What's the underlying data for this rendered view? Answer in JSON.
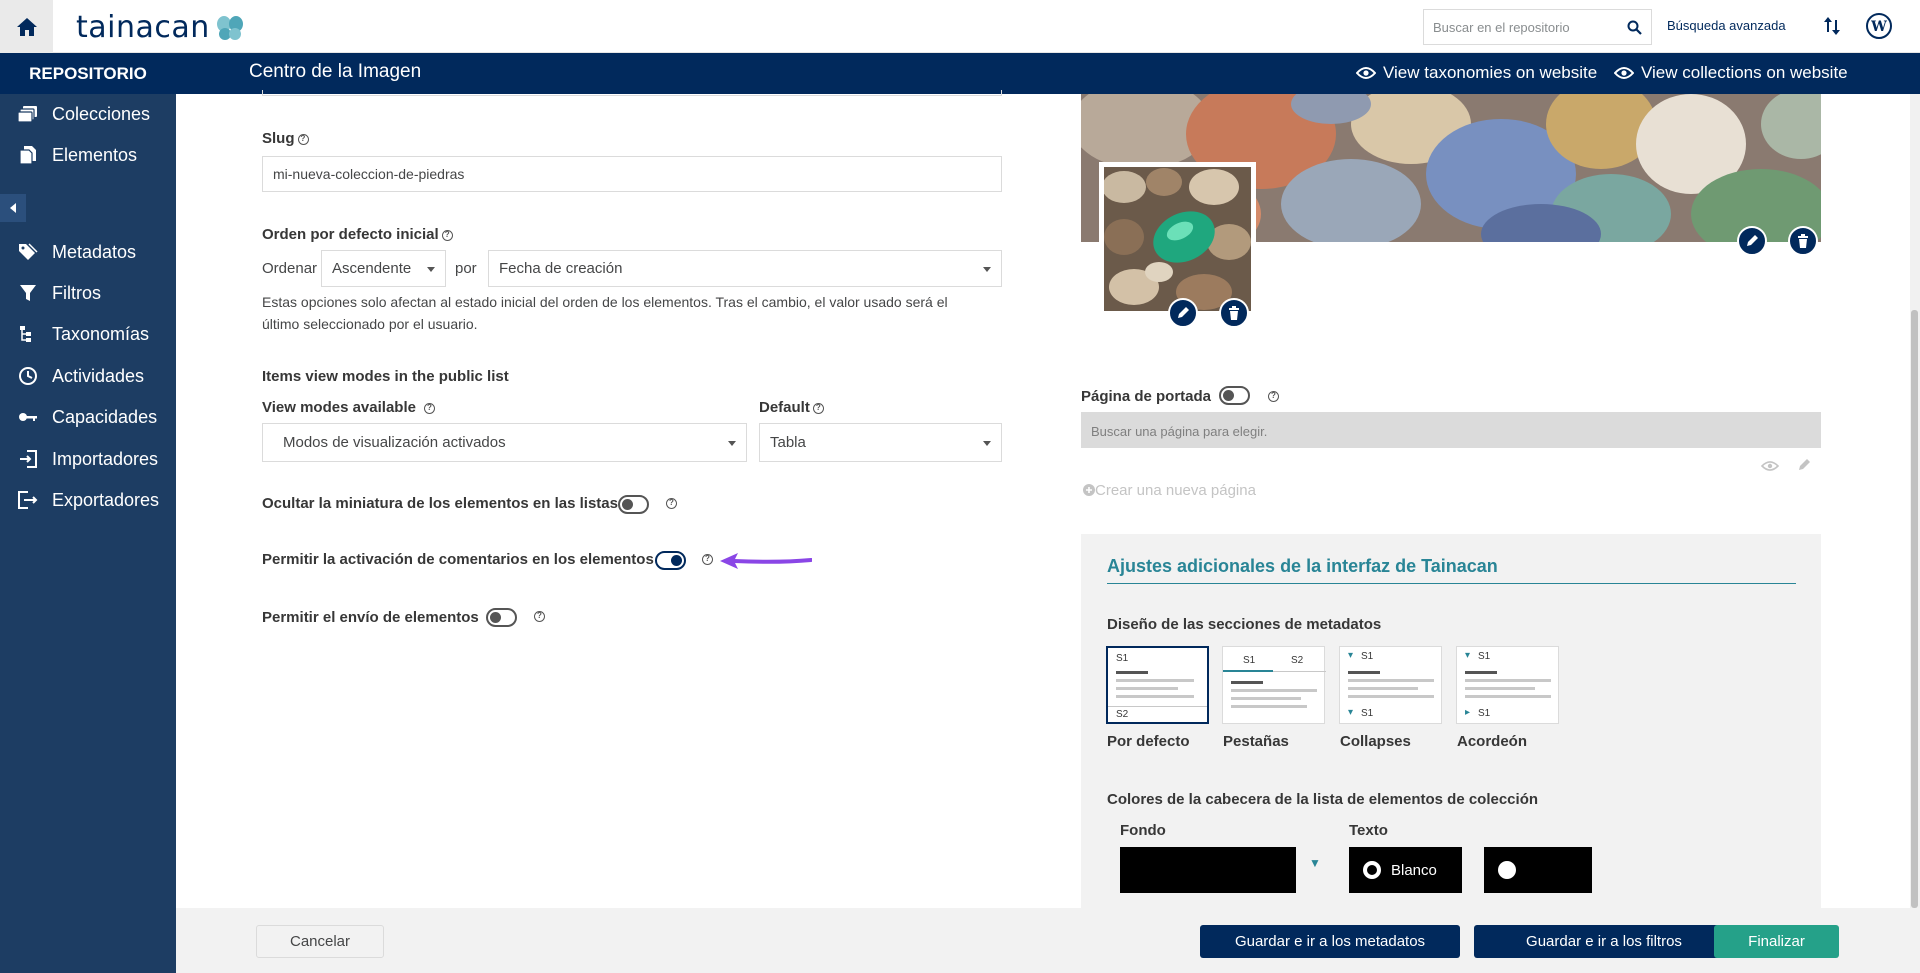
{
  "topbar": {
    "logo_text": "tainacan",
    "search_placeholder": "Buscar en el repositorio",
    "advanced_search": "Búsqueda avanzada"
  },
  "navbar": {
    "repo_label": "REPOSITORIO",
    "page_title": "Centro de la Imagen",
    "view_taxonomies": "View taxonomies on website",
    "view_collections": "View collections on website"
  },
  "sidebar": {
    "items": [
      {
        "label": "Colecciones",
        "icon": "collections-icon"
      },
      {
        "label": "Elementos",
        "icon": "items-icon"
      },
      {
        "label": "Metadatos",
        "icon": "tags-icon"
      },
      {
        "label": "Filtros",
        "icon": "filter-icon"
      },
      {
        "label": "Taxonomías",
        "icon": "taxonomy-icon"
      },
      {
        "label": "Actividades",
        "icon": "activities-icon"
      },
      {
        "label": "Capacidades",
        "icon": "key-icon"
      },
      {
        "label": "Importadores",
        "icon": "import-icon"
      },
      {
        "label": "Exportadores",
        "icon": "export-icon"
      }
    ]
  },
  "form": {
    "slug_label": "Slug",
    "slug_value": "mi-nueva-coleccion-de-piedras",
    "order_label": "Orden por defecto inicial",
    "order_prefix": "Ordenar",
    "order_value": "Ascendente",
    "order_by": "por",
    "order_field": "Fecha de creación",
    "order_note_1": "Estas opciones solo afectan al estado inicial del orden de los elementos. Tras el cambio, el valor usado será el",
    "order_note_2": "último seleccionado por el usuario.",
    "view_modes_title": "Items view modes in the public list",
    "view_modes_label": "View modes available",
    "view_modes_value": "Modos de visualización activados",
    "default_label": "Default",
    "default_value": "Tabla",
    "hide_thumb_label": "Ocultar la miniatura de los elementos en las listas",
    "hide_thumb_on": false,
    "comments_label": "Permitir la activación de comentarios en los elementos",
    "comments_on": true,
    "submission_label": "Permitir el envío de elementos",
    "submission_on": false
  },
  "right": {
    "portada_label": "Página de portada",
    "portada_on": false,
    "portada_placeholder": "Buscar una página para elegir.",
    "crear_label": "Crear una nueva página",
    "extra_title": "Ajustes adicionales de la interfaz de Tainacan",
    "layout_label": "Diseño de las secciones de metadatos",
    "layouts": [
      {
        "name": "Por defecto",
        "selected": true
      },
      {
        "name": "Pestañas",
        "selected": false
      },
      {
        "name": "Collapses",
        "selected": false
      },
      {
        "name": "Acordeón",
        "selected": false
      }
    ],
    "colors_label": "Colores de la cabecera de la lista de elementos de colección",
    "fondo_label": "Fondo",
    "texto_label": "Texto",
    "texto_option_1": "Blanco",
    "fondo_color": "#000000",
    "texto_color": "#000000"
  },
  "footer": {
    "cancel": "Cancelar",
    "save_metadata": "Guardar e ir a los metadatos",
    "save_filters": "Guardar e ir a los filtros",
    "finish": "Finalizar"
  },
  "colors": {
    "brand": "#01295c",
    "sidebar": "#1d3d63",
    "accent_teal": "#298596",
    "finish_green": "#25a189",
    "arrow_purple": "#8a46e6"
  }
}
